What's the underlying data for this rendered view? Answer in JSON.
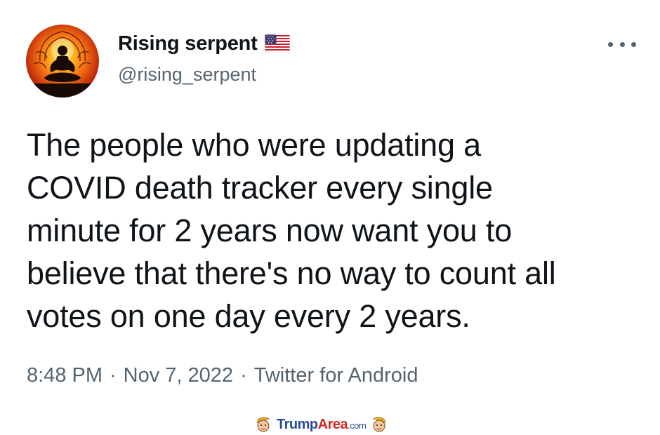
{
  "tweet": {
    "author": {
      "display_name": "Rising serpent",
      "handle": "@rising_serpent",
      "flag_icon": "us-flag-icon",
      "avatar_icon": "meditating-figure-icon"
    },
    "text_lines": [
      "The people who were updating a",
      "COVID death tracker every single",
      "minute for 2 years now want you to",
      "believe that there's no way to count all",
      "votes on one day every 2 years."
    ],
    "meta": {
      "time": "8:48 PM",
      "separator": "·",
      "date": "Nov 7, 2022",
      "source": "Twitter for Android"
    },
    "more_icon": "more-options-icon"
  },
  "watermark": {
    "logo": "TrumpArea.com"
  },
  "colors": {
    "text": "#0f1419",
    "secondary": "#536471",
    "watermark_blue": "#2c4a9c",
    "watermark_red": "#d9261c"
  }
}
